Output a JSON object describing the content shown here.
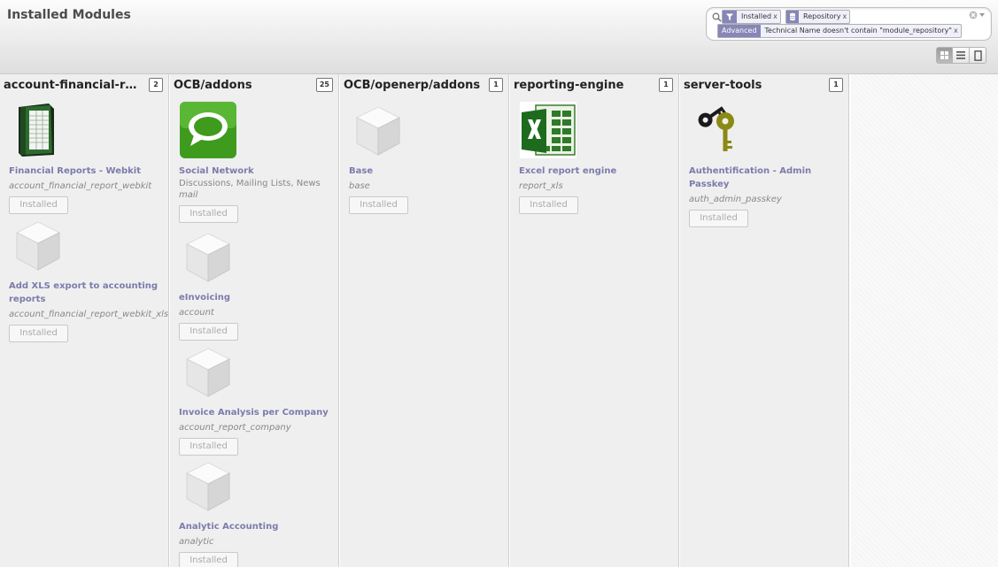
{
  "page": {
    "title": "Installed Modules"
  },
  "search": {
    "facets": [
      {
        "category": "filter-icon",
        "value": "Installed",
        "remove": "x"
      },
      {
        "category": "database-icon",
        "value": "Repository",
        "remove": "x"
      },
      {
        "category": "Advanced",
        "value": "Technical Name doesn't contain \"module_repository\"",
        "remove": "x"
      }
    ]
  },
  "view_switcher": [
    "kanban-view-icon",
    "list-view-icon",
    "form-view-icon"
  ],
  "columns": [
    {
      "title": "account-financial-report-webkit",
      "count": "2",
      "cards": [
        {
          "icon": "ledger-book-icon",
          "name": "Financial Reports - Webkit",
          "summary": "",
          "technical": "account_financial_report_webkit",
          "status": "Installed"
        },
        {
          "icon": "cube-icon",
          "name": "Add XLS export to accounting reports",
          "summary": "",
          "technical": "account_financial_report_webkit_xls",
          "status": "Installed"
        }
      ]
    },
    {
      "title": "OCB/addons",
      "count": "25",
      "cards": [
        {
          "icon": "speech-bubble-icon",
          "name": "Social Network",
          "summary": "Discussions, Mailing Lists, News",
          "technical": "mail",
          "status": "Installed"
        },
        {
          "icon": "cube-icon",
          "name": "eInvoicing",
          "summary": "",
          "technical": "account",
          "status": "Installed"
        },
        {
          "icon": "cube-icon",
          "name": "Invoice Analysis per Company",
          "summary": "",
          "technical": "account_report_company",
          "status": "Installed"
        },
        {
          "icon": "cube-icon",
          "name": "Analytic Accounting",
          "summary": "",
          "technical": "analytic",
          "status": "Installed"
        }
      ]
    },
    {
      "title": "OCB/openerp/addons",
      "count": "1",
      "cards": [
        {
          "icon": "cube-icon",
          "name": "Base",
          "summary": "",
          "technical": "base",
          "status": "Installed"
        }
      ]
    },
    {
      "title": "reporting-engine",
      "count": "1",
      "cards": [
        {
          "icon": "excel-icon",
          "name": "Excel report engine",
          "summary": "",
          "technical": "report_xls",
          "status": "Installed"
        }
      ]
    },
    {
      "title": "server-tools",
      "count": "1",
      "cards": [
        {
          "icon": "keys-icon",
          "name": "Authentification - Admin Passkey",
          "summary": "",
          "technical": "auth_admin_passkey",
          "status": "Installed"
        }
      ]
    }
  ]
}
